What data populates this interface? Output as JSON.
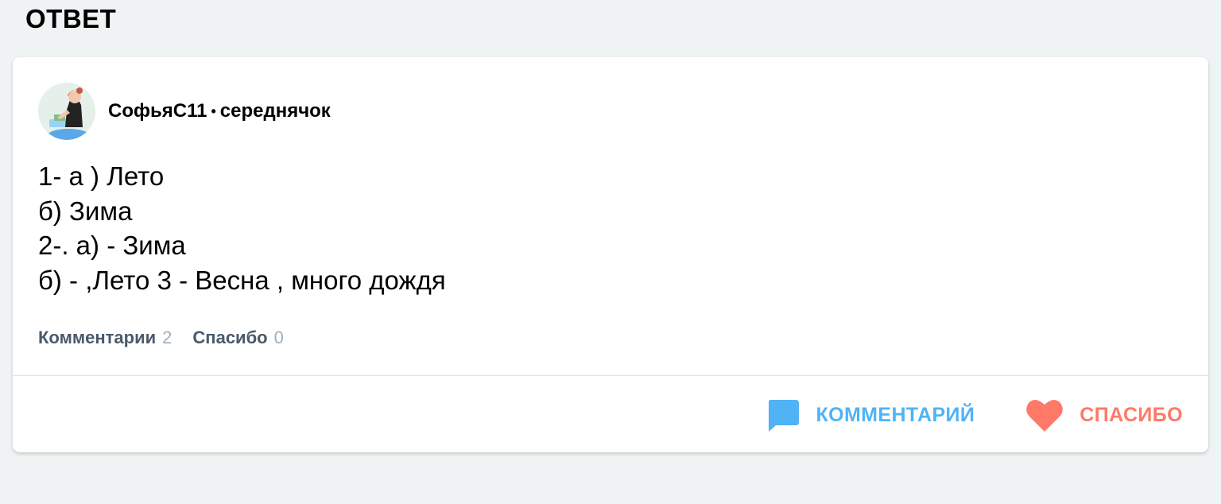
{
  "page": {
    "heading": "ОТВЕТ"
  },
  "answer": {
    "author": {
      "name": "СофьяС11",
      "separator": "•",
      "rank": "середнячок"
    },
    "lines": [
      "1- а ) Лето",
      "б) Зима",
      "2-. а) - Зима",
      "б) - ,Лето 3 - Весна , много дождя"
    ],
    "stats": {
      "comments_label": "Комментарии",
      "comments_count": "2",
      "thanks_label": "Спасибо",
      "thanks_count": "0"
    },
    "actions": {
      "comment_label": "КОММЕНТАРИЙ",
      "comment_icon": "speech-bubble-icon",
      "thanks_label": "СПАСИБО",
      "thanks_icon": "heart-icon"
    }
  },
  "colors": {
    "background": "#f0f3f4",
    "comment_accent": "#4fb3f6",
    "thanks_accent": "#ff7968",
    "stat_label": "#4a5a6a",
    "stat_count": "#9fb0bd"
  }
}
